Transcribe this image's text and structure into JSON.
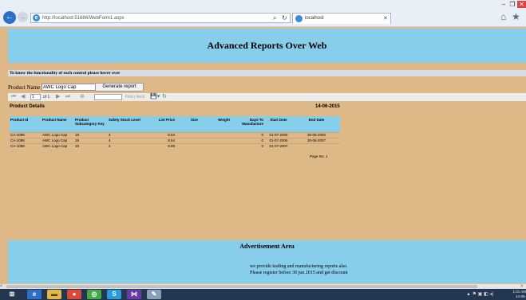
{
  "browser": {
    "url": "http://localhost:51686/WebForm1.aspx",
    "tab_title": "localhost",
    "window_controls": {
      "minimize": "–",
      "maximize": "❐",
      "close": "✕"
    },
    "icons": {
      "back": "←",
      "forward": "→",
      "search": "⌕",
      "refresh": "↻",
      "tab_close": "✕",
      "home": "⌂",
      "favorites": "★"
    }
  },
  "page": {
    "title": "Advanced Reports Over Web",
    "hint": "To know the functionality of each control please hover over",
    "form": {
      "product_label": "Product Name",
      "product_value": "AWC Logo Cap",
      "generate_button": "Generate report"
    },
    "toolbar": {
      "first": "⏮",
      "prev": "◀",
      "page_current": "1",
      "page_of": "of 1",
      "next": "▶",
      "last": "⏭",
      "back": "⊛",
      "find_label": "Find | Next",
      "export_icon": "💾▾",
      "refresh_icon": "↻"
    },
    "report": {
      "title": "Product Details",
      "date": "14-06-2015",
      "columns": [
        "Product Id",
        "Product Name",
        "Product Subcategory Key",
        "Safety Stock Level",
        "List Price",
        "Size",
        "Weight",
        "Days To Manufacture",
        "Start Date",
        "End Date"
      ],
      "rows": [
        [
          "CA-1098",
          "AWC Logo Cap",
          "19",
          "4",
          "8.64",
          "",
          "",
          "0",
          "01-07-2005",
          "30-06-2006"
        ],
        [
          "CA-1098",
          "AWC Logo Cap",
          "19",
          "4",
          "8.64",
          "",
          "",
          "0",
          "01-07-2006",
          "30-06-2007"
        ],
        [
          "CA-1098",
          "AWC Logo Cap",
          "19",
          "4",
          "8.99",
          "",
          "",
          "0",
          "01-07-2007",
          ""
        ]
      ],
      "page_no": "Page No. 1"
    },
    "ad": {
      "title": "Advertisement Area",
      "line1": "we provide trading and manufacturing reports also.",
      "line2": "Please register before 30 jun 2015 and get discount"
    }
  },
  "taskbar": {
    "start_icon": "⊞",
    "apps": [
      "e",
      "▬",
      "●",
      "◎",
      "S",
      "⋈",
      "✎"
    ],
    "tray": "▲ ⚑ ▣ ◧ ◂)",
    "time": "1:31 AM",
    "date": "14-06-2015"
  },
  "scroll": {
    "left": "<",
    "right": ">"
  }
}
